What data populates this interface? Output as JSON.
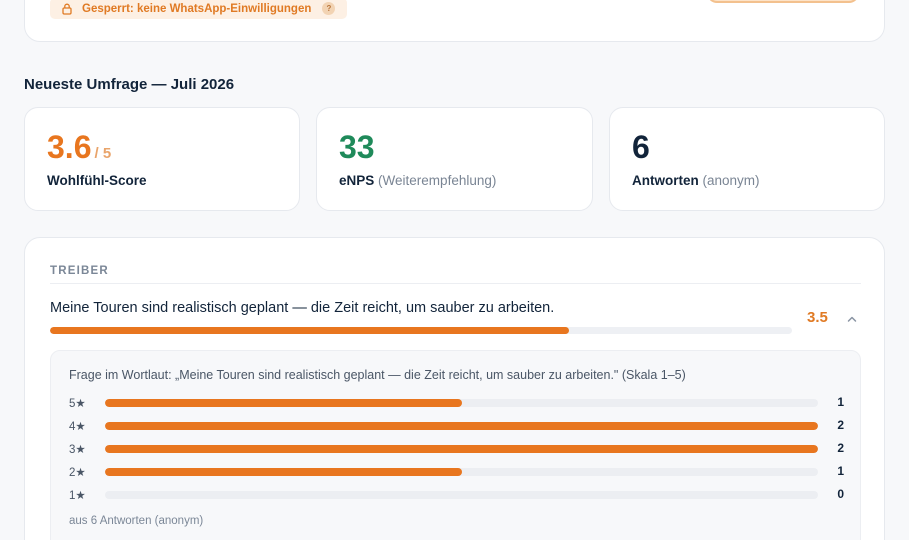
{
  "top_card": {
    "locked_badge_label": "Gesperrt: keine WhatsApp-Einwilligungen",
    "help_glyph": "?"
  },
  "section_title": "Neueste Umfrage — Juli 2026",
  "stats": {
    "wellbeing": {
      "value": "3.6",
      "suffix": "/ 5",
      "label": "Wohlfühl-Score",
      "color": "#e8761f"
    },
    "enps": {
      "value": "33",
      "label": "eNPS",
      "sub": "(Weiterempfehlung)",
      "color": "#1f8a5a"
    },
    "responses": {
      "value": "6",
      "label": "Antworten",
      "sub": "(anonym)",
      "color": "#12243a"
    }
  },
  "drivers": {
    "heading": "TREIBER",
    "question": "Meine Touren sind realistisch geplant — die Zeit reicht, um sauber zu arbeiten.",
    "score": "3.5",
    "score_fraction": 0.7,
    "detail": {
      "question_full": "Frage im Wortlaut: „Meine Touren sind realistisch geplant — die Zeit reicht, um sauber zu arbeiten.\" (Skala 1–5)",
      "distribution": [
        {
          "label": "5★",
          "count": 1
        },
        {
          "label": "4★",
          "count": 2
        },
        {
          "label": "3★",
          "count": 2
        },
        {
          "label": "2★",
          "count": 1
        },
        {
          "label": "1★",
          "count": 0
        }
      ],
      "max_count": 2,
      "footer": "aus 6 Antworten (anonym)"
    }
  }
}
